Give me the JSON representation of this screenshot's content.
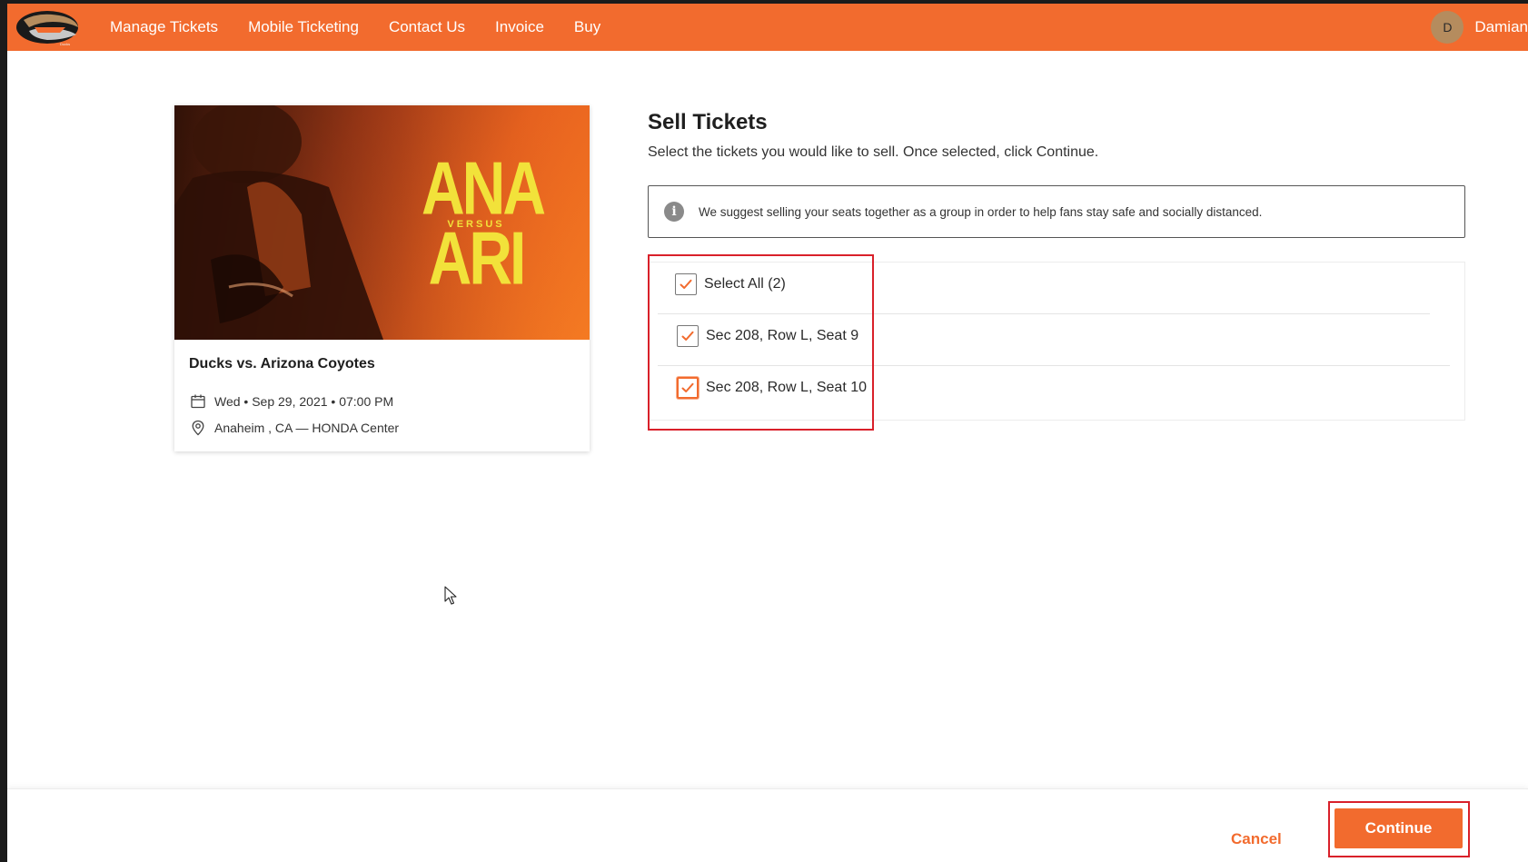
{
  "nav": {
    "logo_alt": "Anaheim Ducks logo",
    "links": [
      "Manage Tickets",
      "Mobile Ticketing",
      "Contact Us",
      "Invoice",
      "Buy"
    ],
    "user_initial": "D",
    "user_name": "Damian"
  },
  "event": {
    "image_team_home": "ANA",
    "image_versus": "VERSUS",
    "image_team_away": "ARI",
    "title": "Ducks vs. Arizona Coyotes",
    "date": "Wed • Sep 29, 2021 • 07:00 PM",
    "location": "Anaheim , CA — HONDA Center"
  },
  "sell": {
    "title": "Sell Tickets",
    "subtitle": "Select the tickets you would like to sell. Once selected, click Continue.",
    "info": "We suggest selling your seats together as a group in order to help fans stay safe and socially distanced.",
    "select_all": {
      "label": "Select All (2)",
      "checked": true
    },
    "tickets": [
      {
        "label": "Sec 208, Row L, Seat 9",
        "checked": true
      },
      {
        "label": "Sec 208, Row L, Seat 10",
        "checked": true
      }
    ]
  },
  "footer": {
    "cancel_label": "Cancel",
    "continue_label": "Continue"
  },
  "colors": {
    "brand_orange": "#f26b2e",
    "highlight_red": "#d9202a"
  }
}
